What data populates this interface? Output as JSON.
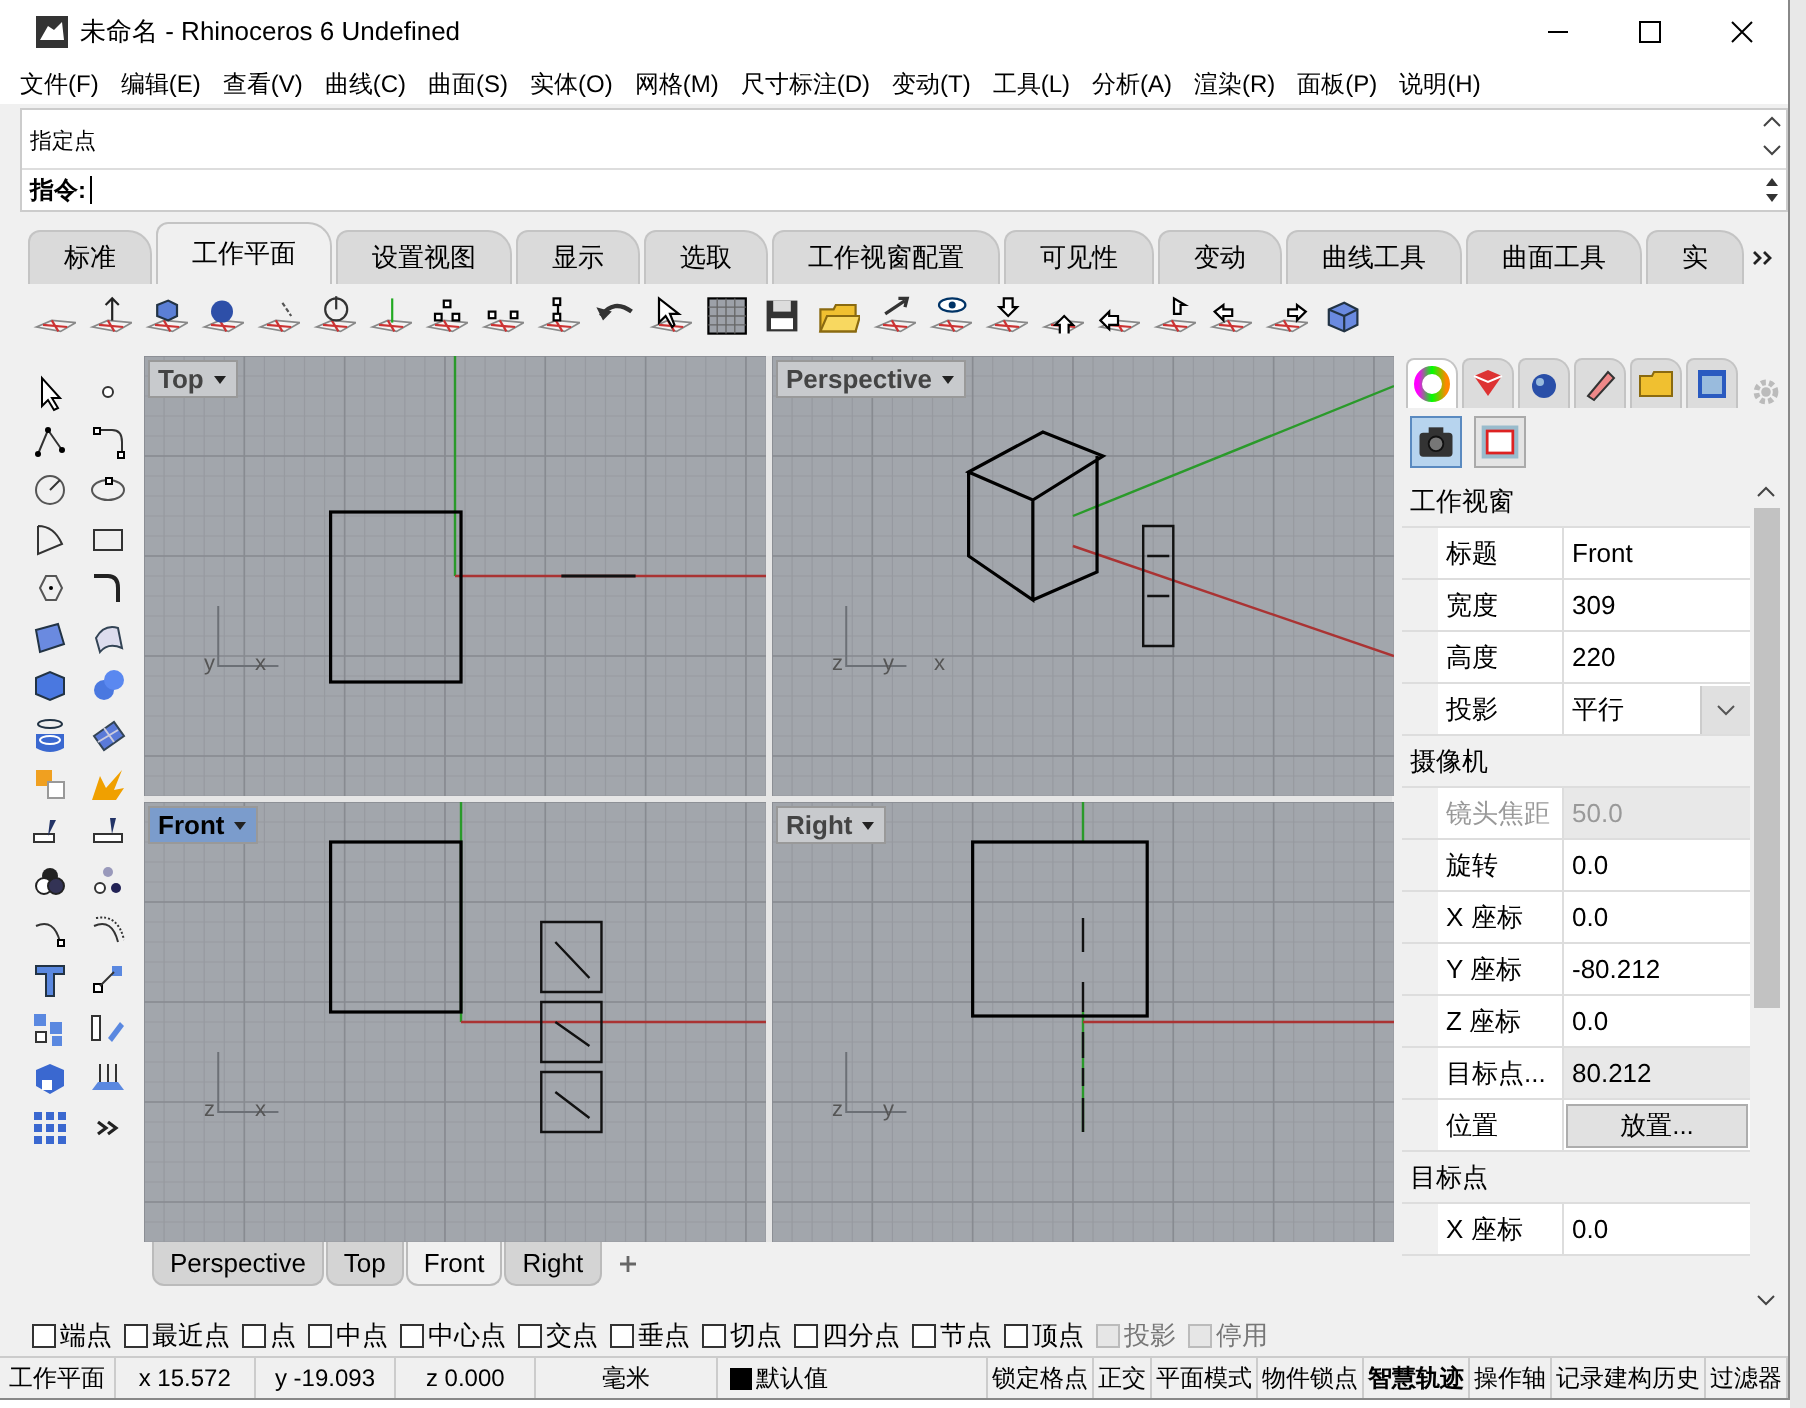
{
  "window": {
    "title": "未命名 - Rhinoceros 6 Undefined"
  },
  "menu": [
    "文件(F)",
    "编辑(E)",
    "查看(V)",
    "曲线(C)",
    "曲面(S)",
    "实体(O)",
    "网格(M)",
    "尺寸标注(D)",
    "变动(T)",
    "工具(L)",
    "分析(A)",
    "渲染(R)",
    "面板(P)",
    "说明(H)"
  ],
  "command": {
    "history": [
      "指定点"
    ],
    "prompt": "指令:"
  },
  "toolbar_tabs": [
    {
      "label": "标准",
      "selected": false
    },
    {
      "label": "工作平面",
      "selected": true
    },
    {
      "label": "设置视图",
      "selected": false
    },
    {
      "label": "显示",
      "selected": false
    },
    {
      "label": "选取",
      "selected": false
    },
    {
      "label": "工作视窗配置",
      "selected": false
    },
    {
      "label": "可见性",
      "selected": false
    },
    {
      "label": "变动",
      "selected": false
    },
    {
      "label": "曲线工具",
      "selected": false
    },
    {
      "label": "曲面工具",
      "selected": false
    },
    {
      "label": "实",
      "selected": false
    }
  ],
  "viewports": [
    {
      "title": "Top",
      "kind": "top",
      "active": false,
      "axis_labels": [
        "y",
        "x"
      ]
    },
    {
      "title": "Perspective",
      "kind": "perspective",
      "active": false,
      "axis_labels": [
        "z",
        "y",
        "x"
      ]
    },
    {
      "title": "Front",
      "kind": "front",
      "active": true,
      "axis_labels": [
        "z",
        "x"
      ]
    },
    {
      "title": "Right",
      "kind": "right",
      "active": false,
      "axis_labels": [
        "z",
        "y"
      ]
    }
  ],
  "viewport_tabs": [
    {
      "label": "Perspective",
      "selected": false
    },
    {
      "label": "Top",
      "selected": false
    },
    {
      "label": "Front",
      "selected": true
    },
    {
      "label": "Right",
      "selected": false
    }
  ],
  "panel": {
    "sections": [
      {
        "title": "工作视窗",
        "rows": [
          {
            "label": "标题",
            "value": "Front",
            "kind": "text"
          },
          {
            "label": "宽度",
            "value": "309",
            "kind": "text"
          },
          {
            "label": "高度",
            "value": "220",
            "kind": "text"
          },
          {
            "label": "投影",
            "value": "平行",
            "kind": "dropdown"
          }
        ]
      },
      {
        "title": "摄像机",
        "rows": [
          {
            "label": "镜头焦距",
            "value": "50.0",
            "kind": "disabled"
          },
          {
            "label": "旋转",
            "value": "0.0",
            "kind": "text"
          },
          {
            "label": "X 座标",
            "value": "0.0",
            "kind": "text"
          },
          {
            "label": "Y 座标",
            "value": "-80.212",
            "kind": "text"
          },
          {
            "label": "Z 座标",
            "value": "0.0",
            "kind": "text"
          },
          {
            "label": "目标点...",
            "value": "80.212",
            "kind": "readonly"
          },
          {
            "label": "位置",
            "value": "放置...",
            "kind": "button"
          }
        ]
      },
      {
        "title": "目标点",
        "rows": [
          {
            "label": "X 座标",
            "value": "0.0",
            "kind": "text"
          }
        ]
      }
    ]
  },
  "osnaps": [
    {
      "label": "端点",
      "checked": false,
      "disabled": false
    },
    {
      "label": "最近点",
      "checked": false,
      "disabled": false
    },
    {
      "label": "点",
      "checked": false,
      "disabled": false
    },
    {
      "label": "中点",
      "checked": false,
      "disabled": false
    },
    {
      "label": "中心点",
      "checked": false,
      "disabled": false
    },
    {
      "label": "交点",
      "checked": false,
      "disabled": false
    },
    {
      "label": "垂点",
      "checked": false,
      "disabled": false
    },
    {
      "label": "切点",
      "checked": false,
      "disabled": false
    },
    {
      "label": "四分点",
      "checked": false,
      "disabled": false
    },
    {
      "label": "节点",
      "checked": false,
      "disabled": false
    },
    {
      "label": "顶点",
      "checked": false,
      "disabled": false
    },
    {
      "label": "投影",
      "checked": false,
      "disabled": true
    },
    {
      "label": "停用",
      "checked": false,
      "disabled": true
    }
  ],
  "status_bar": {
    "cplane": "工作平面",
    "x": "x 15.572",
    "y": "y -19.093",
    "z": "z 0.000",
    "units": "毫米",
    "layer": "默认值",
    "toggles": [
      {
        "label": "锁定格点",
        "on": false
      },
      {
        "label": "正交",
        "on": false
      },
      {
        "label": "平面模式",
        "on": false
      },
      {
        "label": "物件锁点",
        "on": false
      },
      {
        "label": "智慧轨迹",
        "on": true
      },
      {
        "label": "操作轴",
        "on": false
      },
      {
        "label": "记录建构历史",
        "on": false
      },
      {
        "label": "过滤器",
        "on": false
      }
    ]
  }
}
